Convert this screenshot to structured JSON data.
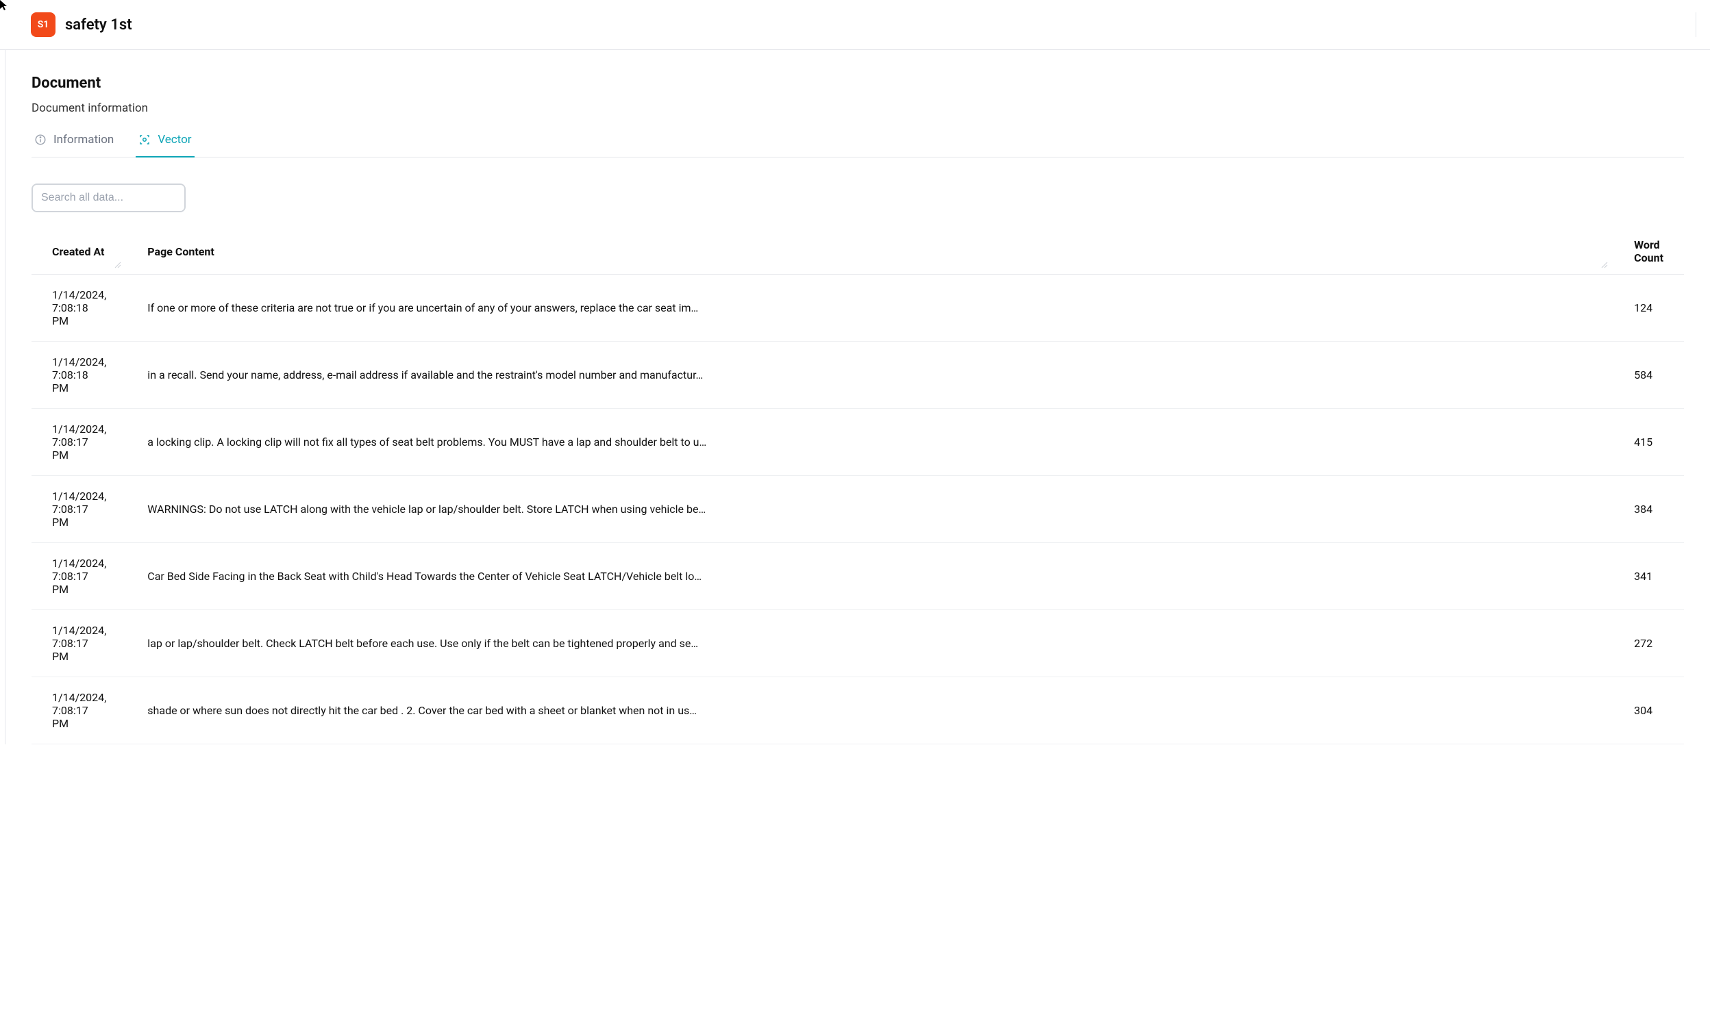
{
  "app": {
    "badge_text": "S1",
    "title": "safety 1st"
  },
  "page": {
    "heading": "Document",
    "subheading": "Document information"
  },
  "tabs": [
    {
      "id": "information",
      "label": "Information",
      "active": false
    },
    {
      "id": "vector",
      "label": "Vector",
      "active": true
    }
  ],
  "search": {
    "placeholder": "Search all data..."
  },
  "table": {
    "columns": {
      "created_at": "Created At",
      "page_content": "Page Content",
      "word_count": "Word Count"
    },
    "rows": [
      {
        "created_at": "1/14/2024, 7:08:18 PM",
        "page_content": "If one or more of these criteria are not true or if you are uncertain of any of your answers, replace the car seat im…",
        "word_count": "124"
      },
      {
        "created_at": "1/14/2024, 7:08:18 PM",
        "page_content": "in a recall. Send your name, address, e-mail address if available and the restraint's model number and manufactur…",
        "word_count": "584"
      },
      {
        "created_at": "1/14/2024, 7:08:17 PM",
        "page_content": "a locking clip. A locking clip will not fix all types of seat belt problems. You MUST have a lap and shoulder belt to u…",
        "word_count": "415"
      },
      {
        "created_at": "1/14/2024, 7:08:17 PM",
        "page_content": "WARNINGS: Do not use LATCH along with the vehicle lap or lap/shoulder belt. Store LATCH when using vehicle be…",
        "word_count": "384"
      },
      {
        "created_at": "1/14/2024, 7:08:17 PM",
        "page_content": "Car Bed Side Facing in the Back Seat with Child's Head Towards the Center of Vehicle Seat LATCH/Vehicle belt lo…",
        "word_count": "341"
      },
      {
        "created_at": "1/14/2024, 7:08:17 PM",
        "page_content": "lap or lap/shoulder belt. Check LATCH belt before each use. Use only if the belt can be tightened properly and se…",
        "word_count": "272"
      },
      {
        "created_at": "1/14/2024, 7:08:17 PM",
        "page_content": "shade or where sun does not directly hit the car bed . 2. Cover the car bed with a sheet or blanket when not in us…",
        "word_count": "304"
      }
    ]
  }
}
